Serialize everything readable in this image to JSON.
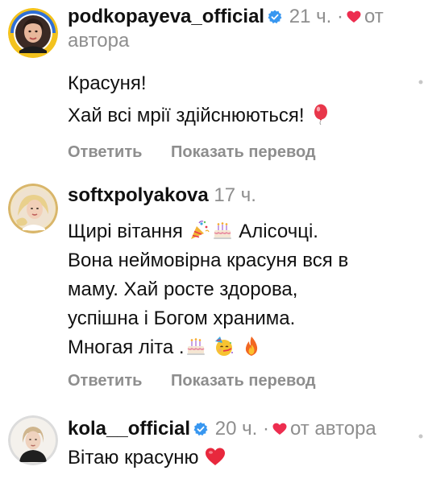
{
  "comments": [
    {
      "username": "podkopayeva_official",
      "verified": true,
      "time": "21 ч.",
      "separator": "·",
      "author_like_label": "от автора",
      "text_lines": [
        "Красуня!",
        "Хай всі мрії здійснюються!"
      ],
      "reply_label": "Ответить",
      "translate_label": "Показать перевод"
    },
    {
      "username": "softxpolyakova",
      "verified": false,
      "time": "17 ч.",
      "text_lines": [
        "Щирі вітання",
        "Алісочці.",
        "Вона неймовірна красуня вся в",
        "маму. Хай росте здорова,",
        "успішна і Богом хранима.",
        "Многая літа ."
      ],
      "reply_label": "Ответить",
      "translate_label": "Показать перевод"
    },
    {
      "username": "kola__official",
      "verified": true,
      "time": "20 ч.",
      "separator": "·",
      "author_like_label": "от автора",
      "text_lines": [
        "Вітаю красуню"
      ]
    }
  ],
  "icons": {
    "verified": "verified-badge-icon",
    "author_heart": "heart-icon",
    "balloon": "balloon-emoji",
    "party_popper": "party-popper-emoji",
    "cake": "birthday-cake-emoji",
    "party_face": "partying-face-emoji",
    "fire": "fire-emoji",
    "red_heart": "red-heart-emoji"
  },
  "colors": {
    "verified_blue": "#3897f0",
    "heart_red": "#ed2d4f",
    "meta_gray": "#8e8e8e",
    "text": "#111111"
  }
}
